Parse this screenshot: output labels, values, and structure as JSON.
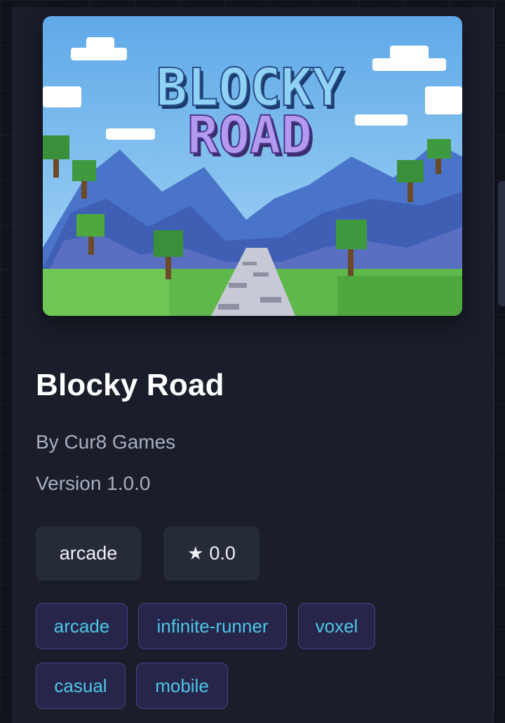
{
  "game": {
    "cover_title_line1": "BLOCKY",
    "cover_title_line2": "ROAD",
    "title": "Blocky Road",
    "author": "By Cur8 Games",
    "version": "Version 1.0.0",
    "category": "arcade",
    "rating_icon": "star-icon",
    "rating": "0.0",
    "tags": [
      "arcade",
      "infinite-runner",
      "voxel",
      "casual",
      "mobile"
    ]
  },
  "colors": {
    "background": "#0f131b",
    "card": "#1a1e2a",
    "chip": "#262b38",
    "tag_bg": "#27264a",
    "tag_border": "#4c3f8e",
    "tag_text": "#4cc6e6"
  }
}
